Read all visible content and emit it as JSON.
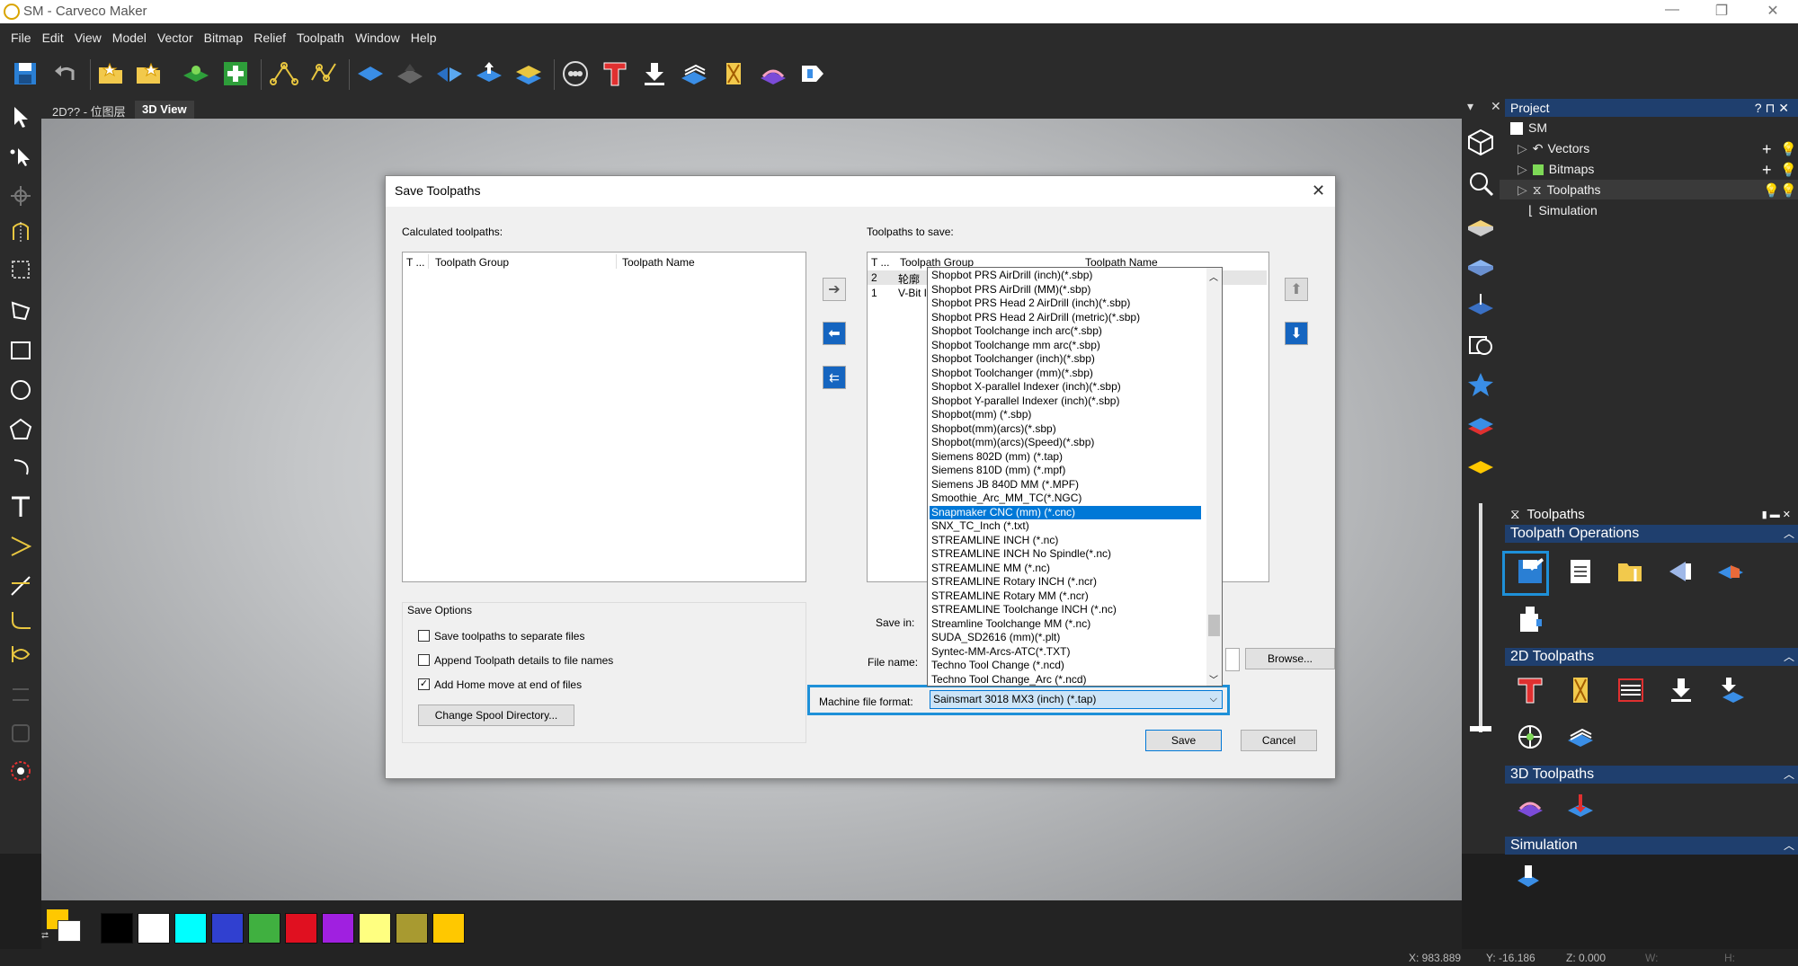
{
  "app": {
    "title": "SM - Carveco Maker"
  },
  "menu": [
    "File",
    "Edit",
    "View",
    "Model",
    "Vector",
    "Bitmap",
    "Relief",
    "Toolpath",
    "Window",
    "Help"
  ],
  "tabs": [
    {
      "label": "2D?? - 位图层"
    },
    {
      "label": "3D View"
    }
  ],
  "project": {
    "header": "Project",
    "root": "SM",
    "items": [
      "Vectors",
      "Bitmaps",
      "Toolpaths",
      "Simulation"
    ]
  },
  "toolpaths_panel": {
    "header": "Toolpaths",
    "sections": {
      "operations": "Toolpath Operations",
      "two_d": "2D Toolpaths",
      "three_d": "3D Toolpaths",
      "simulation": "Simulation"
    }
  },
  "dialog": {
    "title": "Save Toolpaths",
    "calculated_label": "Calculated toolpaths:",
    "to_save_label": "Toolpaths to save:",
    "col_t": "T ...",
    "col_t2": "T ...",
    "col_group": "Toolpath Group",
    "col_name": "Toolpath Name",
    "rows": [
      {
        "t": "2",
        "group": "轮廓"
      },
      {
        "t": "1",
        "group": "V-Bit I"
      }
    ],
    "save_options_label": "Save Options",
    "opt_separate": "Save toolpaths to separate files",
    "opt_append": "Append Toolpath details to file names",
    "opt_home": "Add Home move at end of files",
    "opt_home_checked": true,
    "spool_button": "Change Spool Directory...",
    "save_in_label": "Save in:",
    "file_name_label": "File name:",
    "browse_button": "Browse...",
    "machine_format_label": "Machine file format:",
    "machine_format_value": "Sainsmart 3018 MX3 (inch) (*.tap)",
    "save_button": "Save",
    "cancel_button": "Cancel"
  },
  "format_list": [
    "Shopbot PRS AirDrill (inch)(*.sbp)",
    "Shopbot PRS AirDrill (MM)(*.sbp)",
    "Shopbot PRS Head 2 AirDrill (inch)(*.sbp)",
    "Shopbot PRS Head 2 AirDrill (metric)(*.sbp)",
    "Shopbot Toolchange inch arc(*.sbp)",
    "Shopbot Toolchange mm arc(*.sbp)",
    "Shopbot Toolchanger (inch)(*.sbp)",
    "Shopbot Toolchanger (mm)(*.sbp)",
    "Shopbot X-parallel Indexer (inch)(*.sbp)",
    "Shopbot Y-parallel Indexer (inch)(*.sbp)",
    "Shopbot(mm) (*.sbp)",
    "Shopbot(mm)(arcs)(*.sbp)",
    "Shopbot(mm)(arcs)(Speed)(*.sbp)",
    "Siemens 802D (mm) (*.tap)",
    "Siemens 810D (mm) (*.mpf)",
    "Siemens JB 840D MM (*.MPF)",
    "Smoothie_Arc_MM_TC(*.NGC)",
    "Snapmaker CNC (mm) (*.cnc)",
    "SNX_TC_Inch (*.txt)",
    "STREAMLINE INCH (*.nc)",
    "STREAMLINE INCH No Spindle(*.nc)",
    "STREAMLINE MM (*.nc)",
    "STREAMLINE Rotary INCH (*.ncr)",
    "STREAMLINE Rotary MM (*.ncr)",
    "STREAMLINE Toolchange INCH (*.nc)",
    "Streamline Toolchange MM (*.nc)",
    "SUDA_SD2616 (mm)(*.plt)",
    "Syntec-MM-Arcs-ATC(*.TXT)",
    "Techno Tool Change (*.ncd)",
    "Techno Tool Change_Arc (*.ncd)"
  ],
  "format_selected_index": 17,
  "palette": [
    "#000000",
    "#ffffff",
    "#00ffff",
    "#3040d0",
    "#40b040",
    "#e01020",
    "#a020e0",
    "#ffff80",
    "#a89a30",
    "#ffc800"
  ],
  "colors": {
    "accent": "#1e90d8",
    "panel_header": "#1f3f6e",
    "selection": "#0078d7"
  },
  "status": {
    "x": "X: 983.889",
    "y": "Y: -16.186",
    "z": "Z: 0.000",
    "w": "W:",
    "h": "H:"
  }
}
